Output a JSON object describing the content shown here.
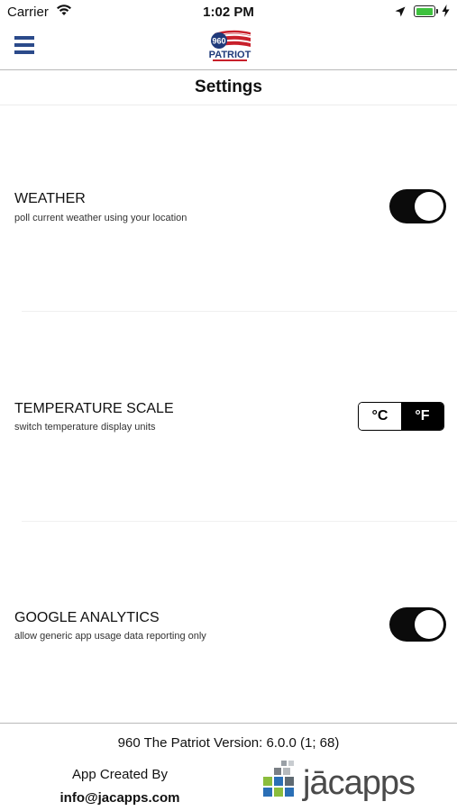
{
  "status_bar": {
    "carrier": "Carrier",
    "time": "1:02 PM",
    "icons": [
      "wifi-icon",
      "location-arrow-icon",
      "battery-icon",
      "charging-bolt-icon"
    ],
    "battery_color": "#3ec13e"
  },
  "nav": {
    "menu_icon": "hamburger-menu-icon",
    "logo": {
      "number": "960",
      "text": "PATRIOT"
    }
  },
  "page_title": "Settings",
  "settings": {
    "weather": {
      "title": "WEATHER",
      "subtitle": "poll current weather using your location",
      "enabled": true
    },
    "temperature": {
      "title": "TEMPERATURE SCALE",
      "subtitle": "switch temperature display units",
      "options": [
        "°C",
        "°F"
      ],
      "selected": "°F"
    },
    "analytics": {
      "title": "GOOGLE ANALYTICS",
      "subtitle": "allow generic app usage data reporting only",
      "enabled": true
    }
  },
  "footer": {
    "version": "960 The Patriot Version: 6.0.0 (1; 68)",
    "created_by": "App Created By",
    "email": "info@jacapps.com",
    "brand": "jācapps"
  },
  "colors": {
    "menu": "#2b4a8a",
    "toggle_on": "#0b0b0b",
    "text": "#111111"
  }
}
